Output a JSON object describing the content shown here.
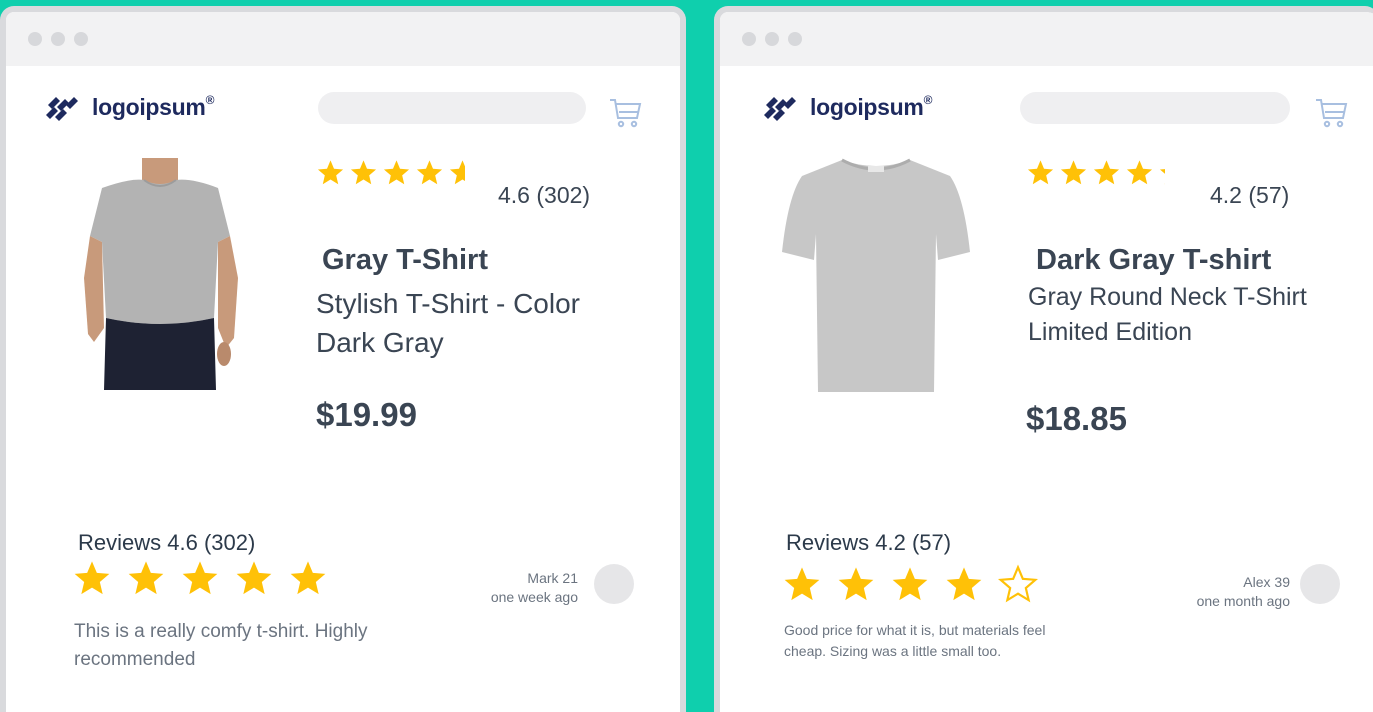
{
  "brand": {
    "name": "logoipsum",
    "mark": "®"
  },
  "colors": {
    "background": "#0fcfad",
    "star": "#ffc107",
    "text": "#3a4553",
    "brand": "#1e2a5e"
  },
  "icons": {
    "cart": "shopping-cart-icon",
    "logo": "logoipsum-mark-icon",
    "star": "star-icon"
  },
  "products": [
    {
      "rating_value": 4.6,
      "rating_text": "4.6 (302)",
      "title": "Gray T-Shirt",
      "subtitle": "Stylish T-Shirt - Color Dark Gray",
      "price": "$19.99",
      "reviews_heading": "Reviews 4.6 (302)",
      "review": {
        "stars": 5,
        "author": "Mark 21",
        "when": "one week ago",
        "text": "This is a really comfy t-shirt. Highly recommended"
      }
    },
    {
      "rating_value": 4.2,
      "rating_text": "4.2 (57)",
      "title": "Dark Gray T-shirt",
      "subtitle": "Gray Round Neck T-Shirt Limited Edition",
      "price": "$18.85",
      "reviews_heading": "Reviews 4.2 (57)",
      "review": {
        "stars": 4,
        "author": "Alex 39",
        "when": "one month ago",
        "text": "Good price for what it is, but materials feel cheap. Sizing was a little small too."
      }
    }
  ]
}
